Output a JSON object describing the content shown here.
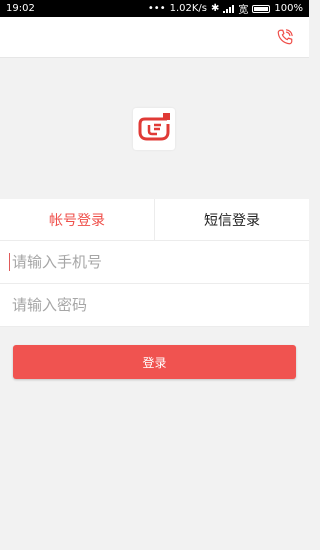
{
  "status_bar": {
    "time": "19:02",
    "network_speed": "1.02K/s",
    "carrier": "宽",
    "battery": "100%",
    "battery_level": 1.0
  },
  "header": {
    "phone_icon": "phone-icon"
  },
  "logo": {
    "icon": "app-logo"
  },
  "tabs": [
    {
      "label": "帐号登录",
      "active": true
    },
    {
      "label": "短信登录",
      "active": false
    }
  ],
  "form": {
    "phone_placeholder": "请输入手机号",
    "phone_value": "",
    "password_placeholder": "请输入密码",
    "password_value": ""
  },
  "login_button": {
    "label": "登录"
  },
  "colors": {
    "accent": "#f05350",
    "background": "#f2f2f2",
    "status_bar": "#000000"
  }
}
